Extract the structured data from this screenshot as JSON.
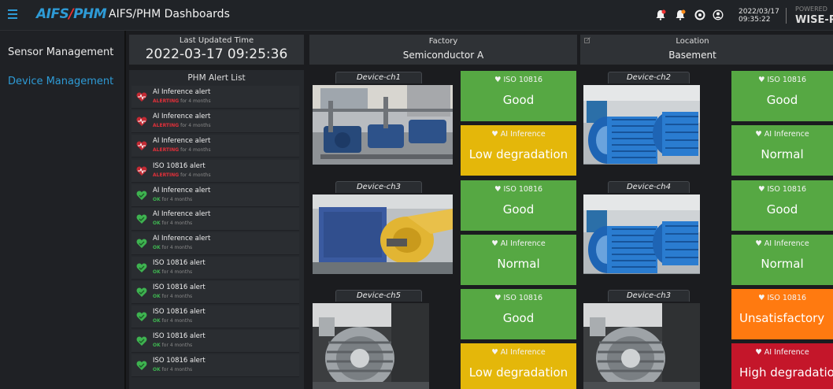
{
  "header": {
    "brand_main": "AIFS",
    "brand_slash": "/",
    "brand_sub": "PHM",
    "title": "AIFS/PHM Dashboards",
    "date": "2022/03/17",
    "time": "09:35:22",
    "powered": "POWERED",
    "vendor": "WISE-Pa",
    "icons": [
      "menu-icon",
      "alert-bell-icon",
      "notification-bell-icon",
      "settings-icon",
      "user-icon"
    ]
  },
  "sidebar": {
    "items": [
      {
        "label": "Sensor Management",
        "active": false
      },
      {
        "label": "Device Management",
        "active": true
      }
    ]
  },
  "summary": {
    "last_updated_label": "Last Updated Time",
    "last_updated_value": "2022-03-17 09:25:36",
    "factory_label": "Factory",
    "factory_value": "Semiconductor A",
    "location_label": "Location",
    "location_value": "Basement"
  },
  "alert_list": {
    "title": "PHM Alert List",
    "items": [
      {
        "title": "AI Inference alert",
        "state": "ALERTING",
        "duration": " for 4 months"
      },
      {
        "title": "AI Inference alert",
        "state": "ALERTING",
        "duration": " for 4 months"
      },
      {
        "title": "AI Inference alert",
        "state": "ALERTING",
        "duration": " for 4 months"
      },
      {
        "title": "ISO 10816 alert",
        "state": "ALERTING",
        "duration": " for 4 months"
      },
      {
        "title": "AI Inference alert",
        "state": "OK",
        "duration": " for 4 months"
      },
      {
        "title": "AI Inference alert",
        "state": "OK",
        "duration": " for 4 months"
      },
      {
        "title": "AI Inference alert",
        "state": "OK",
        "duration": " for 4 months"
      },
      {
        "title": "ISO 10816 alert",
        "state": "OK",
        "duration": " for 4 months"
      },
      {
        "title": "ISO 10816 alert",
        "state": "OK",
        "duration": " for 4 months"
      },
      {
        "title": "ISO 10816 alert",
        "state": "OK",
        "duration": " for 4 months"
      },
      {
        "title": "ISO 10816 alert",
        "state": "OK",
        "duration": " for 4 months"
      },
      {
        "title": "ISO 10816 alert",
        "state": "OK",
        "duration": " for 4 months"
      }
    ]
  },
  "devices": [
    {
      "name": "Device-ch1",
      "iso_label": "ISO 10816",
      "iso_value": "Good",
      "ai_label": "AI Inference",
      "ai_value": "Low degradation"
    },
    {
      "name": "Device-ch2",
      "iso_label": "ISO 10816",
      "iso_value": "Good",
      "ai_label": "AI Inference",
      "ai_value": "Normal"
    },
    {
      "name": "Device-ch3",
      "iso_label": "ISO 10816",
      "iso_value": "Good",
      "ai_label": "AI Inference",
      "ai_value": "Normal"
    },
    {
      "name": "Device-ch4",
      "iso_label": "ISO 10816",
      "iso_value": "Good",
      "ai_label": "AI Inference",
      "ai_value": "Normal"
    },
    {
      "name": "Device-ch5",
      "iso_label": "ISO 10816",
      "iso_value": "Good",
      "ai_label": "AI Inference",
      "ai_value": "Low degradation"
    },
    {
      "name": "Device-ch3",
      "iso_label": "ISO 10816",
      "iso_value": "Unsatisfactory",
      "ai_label": "AI Inference",
      "ai_value": "High degradation"
    }
  ],
  "colors": {
    "accent": "#2e9bd6",
    "good": "#56a843",
    "warning": "#e4b70a",
    "unsatisfactory": "#ff7a10",
    "critical": "#c4162a",
    "alerting_text": "#e0303a",
    "ok_text": "#3eb350"
  }
}
